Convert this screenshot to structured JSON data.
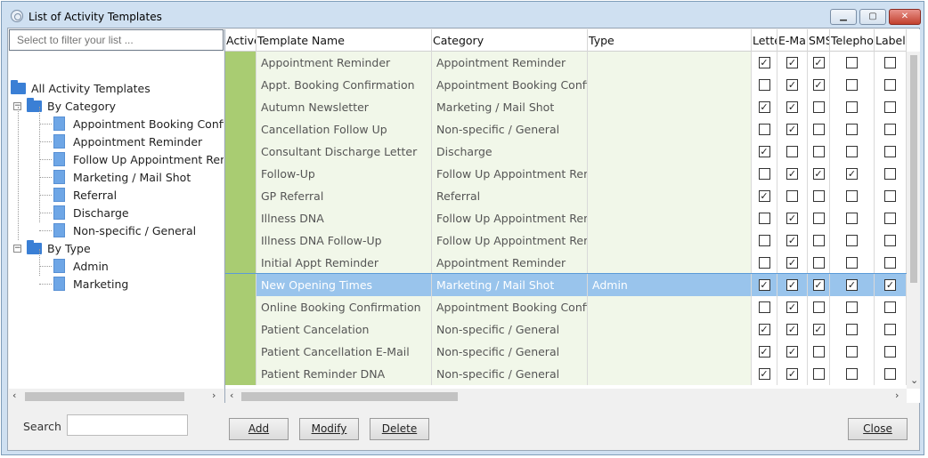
{
  "window": {
    "title": "List of Activity Templates"
  },
  "left": {
    "filter_placeholder": "Select to filter your list ...",
    "root_label": "All Activity Templates",
    "by_category_label": "By Category",
    "categories": [
      "Appointment Booking Confirmation",
      "Appointment Reminder",
      "Follow Up Appointment Reminder",
      "Marketing / Mail Shot",
      "Referral",
      "Discharge",
      "Non-specific / General"
    ],
    "by_type_label": "By Type",
    "types": [
      "Admin",
      "Marketing"
    ],
    "search_label": "Search"
  },
  "grid": {
    "columns": [
      "Active",
      "Template Name",
      "Category",
      "Type",
      "Letter",
      "E-Mail",
      "SMS",
      "Telephone",
      "Label"
    ],
    "rows": [
      {
        "name": "Appointment Reminder",
        "category": "Appointment Reminder",
        "type": "",
        "letter": true,
        "email": true,
        "sms": true,
        "telephone": false,
        "label": false
      },
      {
        "name": "Appt. Booking Confirmation",
        "category": "Appointment Booking Confirmation",
        "type": "",
        "letter": false,
        "email": true,
        "sms": true,
        "telephone": false,
        "label": false
      },
      {
        "name": "Autumn Newsletter",
        "category": "Marketing / Mail Shot",
        "type": "",
        "letter": true,
        "email": true,
        "sms": false,
        "telephone": false,
        "label": false
      },
      {
        "name": "Cancellation Follow Up",
        "category": "Non-specific / General",
        "type": "",
        "letter": false,
        "email": true,
        "sms": false,
        "telephone": false,
        "label": false
      },
      {
        "name": "Consultant Discharge Letter",
        "category": "Discharge",
        "type": "",
        "letter": true,
        "email": false,
        "sms": false,
        "telephone": false,
        "label": false
      },
      {
        "name": "Follow-Up",
        "category": "Follow Up Appointment Reminder",
        "type": "",
        "letter": false,
        "email": true,
        "sms": true,
        "telephone": true,
        "label": false
      },
      {
        "name": "GP Referral",
        "category": "Referral",
        "type": "",
        "letter": true,
        "email": false,
        "sms": false,
        "telephone": false,
        "label": false
      },
      {
        "name": "Illness DNA",
        "category": "Follow Up Appointment Reminder",
        "type": "",
        "letter": false,
        "email": true,
        "sms": false,
        "telephone": false,
        "label": false
      },
      {
        "name": "Illness DNA Follow-Up",
        "category": "Follow Up Appointment Reminder",
        "type": "",
        "letter": false,
        "email": true,
        "sms": false,
        "telephone": false,
        "label": false
      },
      {
        "name": "Initial Appt Reminder",
        "category": "Appointment Reminder",
        "type": "",
        "letter": false,
        "email": true,
        "sms": false,
        "telephone": false,
        "label": false
      },
      {
        "name": "New Opening Times",
        "category": "Marketing / Mail Shot",
        "type": "Admin",
        "letter": true,
        "email": true,
        "sms": true,
        "telephone": true,
        "label": true,
        "selected": true
      },
      {
        "name": "Online Booking Confirmation",
        "category": "Appointment Booking Confirmation",
        "type": "",
        "letter": false,
        "email": true,
        "sms": false,
        "telephone": false,
        "label": false
      },
      {
        "name": "Patient Cancelation",
        "category": "Non-specific / General",
        "type": "",
        "letter": true,
        "email": true,
        "sms": true,
        "telephone": false,
        "label": false
      },
      {
        "name": "Patient Cancellation E-Mail",
        "category": "Non-specific / General",
        "type": "",
        "letter": true,
        "email": true,
        "sms": false,
        "telephone": false,
        "label": false
      },
      {
        "name": "Patient Reminder DNA",
        "category": "Non-specific / General",
        "type": "",
        "letter": true,
        "email": true,
        "sms": false,
        "telephone": false,
        "label": false
      }
    ]
  },
  "buttons": {
    "add": "Add",
    "modify": "Modify",
    "delete": "Delete",
    "close": "Close"
  },
  "colors": {
    "active_cell": "#a9cc72",
    "selected_row": "#99c4ec",
    "folder": "#3a7fd5"
  }
}
